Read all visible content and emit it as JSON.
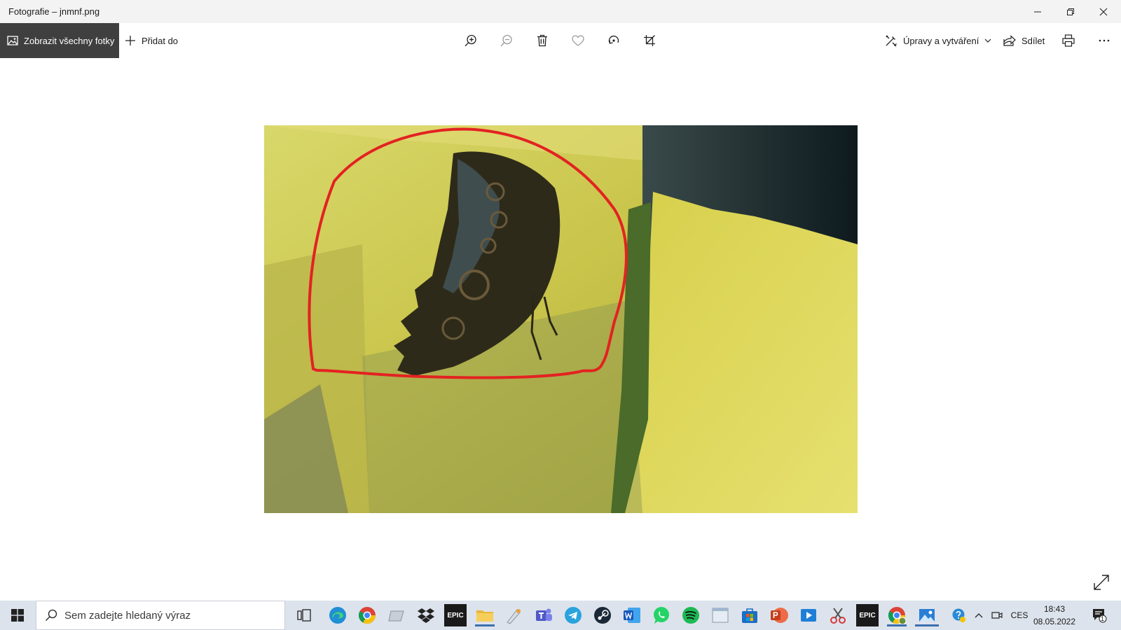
{
  "window": {
    "title": "Fotografie – jnmnf.png"
  },
  "toolbar": {
    "show_all_label": "Zobrazit všechny fotky",
    "add_to_label": "Přidat do",
    "edit_create_label": "Úpravy a vytváření",
    "share_label": "Sdílet"
  },
  "taskbar": {
    "search_placeholder": "Sem zadejte hledaný výraz",
    "language": "CES",
    "time": "18:43",
    "date": "08.05.2022",
    "notification_count": "1",
    "epic_label_1": "EPIC",
    "epic_label_2": "EPIC"
  },
  "colors": {
    "annotation_stroke": "#e32222",
    "taskbar_bg": "#dde3ec",
    "titlebar_bg": "#f3f3f3"
  }
}
